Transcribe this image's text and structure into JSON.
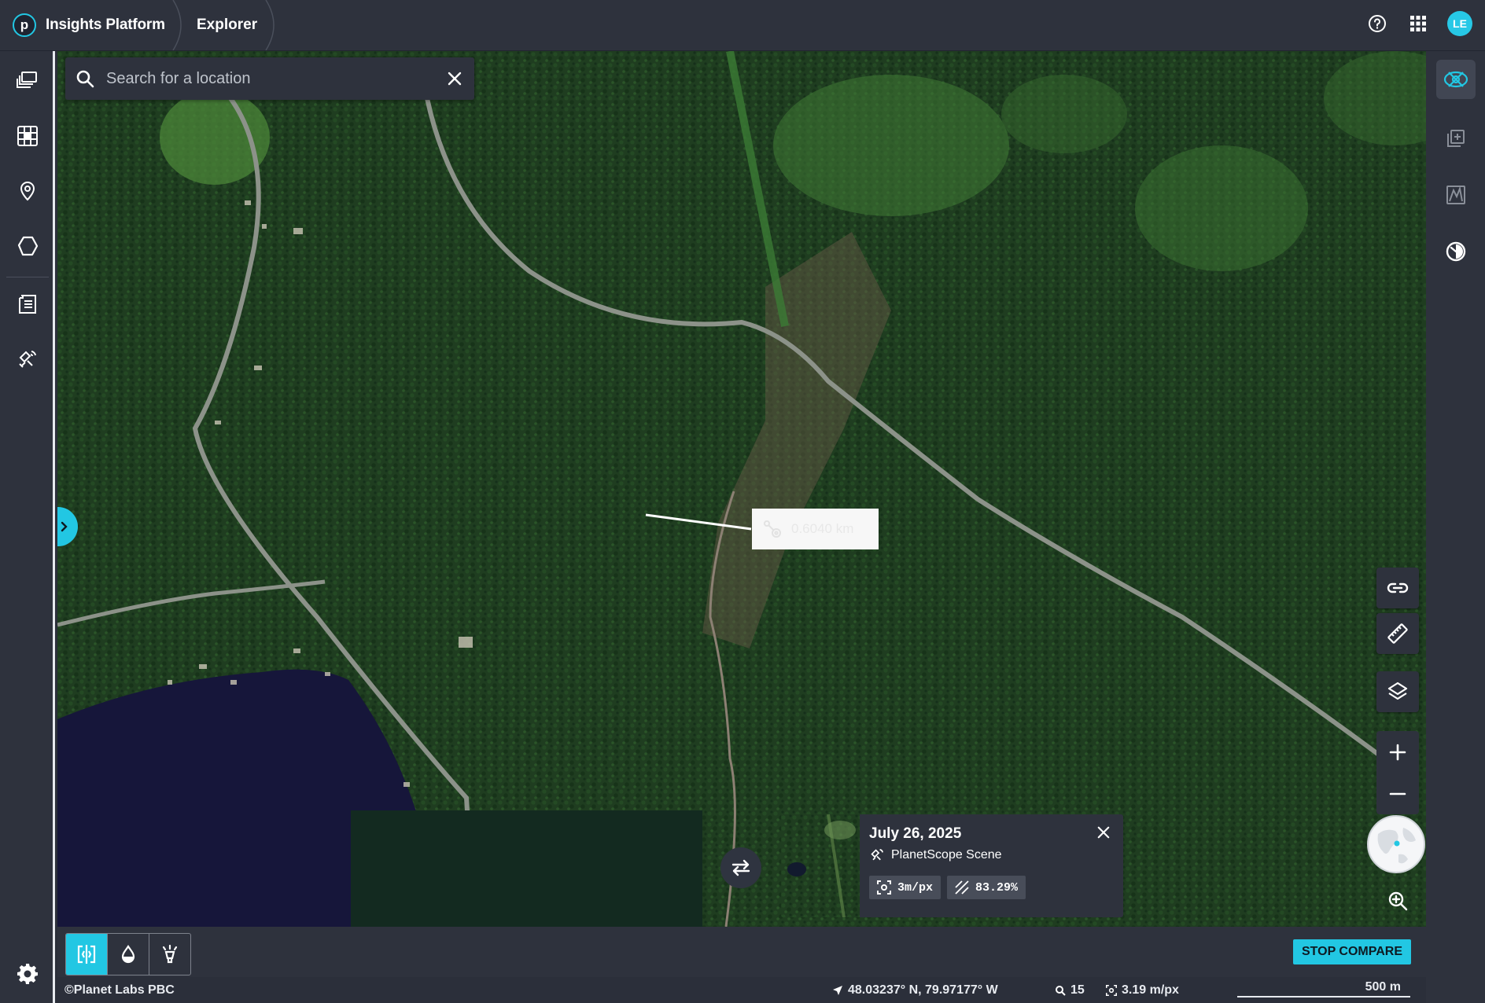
{
  "app": {
    "brand_name": "Insights Platform",
    "logo_letter": "p",
    "current_tab": "Explorer",
    "user_initials": "LE"
  },
  "search": {
    "placeholder": "Search for a location",
    "value": ""
  },
  "measurement": {
    "label": "0.6040 km"
  },
  "scene": {
    "date": "July 26, 2025",
    "type": "PlanetScope Scene",
    "resolution": "3m/px",
    "coverage": "83.29%"
  },
  "toolbar": {
    "stop_compare_label": "STOP COMPARE"
  },
  "status": {
    "copyright": "©Planet Labs PBC",
    "coordinates": "48.03237° N, 79.97177° W",
    "zoom": "15",
    "resolution": "3.19 m/px",
    "scale": "500 m"
  },
  "colors": {
    "accent": "#22c7e3",
    "panel": "#2e323d",
    "forest": "#1e3a1f",
    "water": "#16163a"
  }
}
